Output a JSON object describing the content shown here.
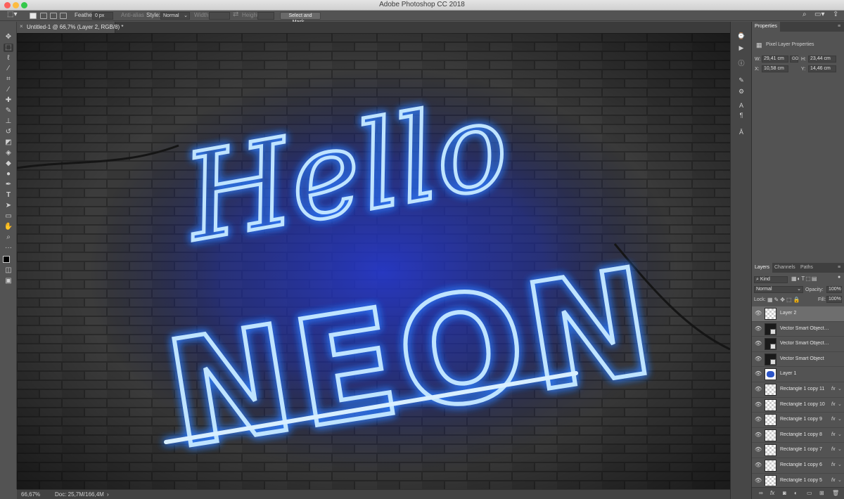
{
  "window": {
    "title": "Adobe Photoshop CC 2018"
  },
  "options_bar": {
    "feather_label": "Feather:",
    "feather_value": "0 px",
    "anti_alias_label": "Anti-alias",
    "style_label": "Style:",
    "style_value": "Normal",
    "width_label": "Width:",
    "height_label": "Height:",
    "select_mask_label": "Select and Mask..."
  },
  "document_tab": {
    "close": "×",
    "title": "Untitled-1 @ 66,7% (Layer 2, RGB/8) *"
  },
  "artwork": {
    "line1": "Hello",
    "line2": "NEON",
    "neon_color": "#4aa8ff",
    "glow_color": "#1e3dcc"
  },
  "status_bar": {
    "zoom": "66,67%",
    "doc_info": "Doc: 25,7M/166,4M",
    "arrow": "›"
  },
  "properties_panel": {
    "tab": "Properties",
    "header": "Pixel Layer Properties",
    "w_label": "W:",
    "w_value": "29,41 cm",
    "link_label": "GO",
    "h_label": "H:",
    "h_value": "23,44 cm",
    "x_label": "X:",
    "x_value": "10,58 cm",
    "y_label": "Y:",
    "y_value": "14,46 cm"
  },
  "layers_panel": {
    "tabs": [
      "Layers",
      "Channels",
      "Paths"
    ],
    "kind_label": "Kind",
    "blend_mode": "Normal",
    "opacity_label": "Opacity:",
    "opacity_value": "100%",
    "lock_label": "Lock:",
    "fill_label": "Fill:",
    "fill_value": "100%",
    "fx_label": "fx",
    "layers": [
      {
        "name": "Layer 2",
        "thumb": "checker",
        "fx": false,
        "selected": true
      },
      {
        "name": "Vector Smart Object c...",
        "thumb": "vec",
        "fx": false,
        "selected": false
      },
      {
        "name": "Vector Smart Object c...",
        "thumb": "vec",
        "fx": false,
        "selected": false
      },
      {
        "name": "Vector Smart Object",
        "thumb": "vec",
        "fx": false,
        "selected": false
      },
      {
        "name": "Layer 1",
        "thumb": "blue",
        "fx": false,
        "selected": false
      },
      {
        "name": "Rectangle 1 copy 11",
        "thumb": "checker",
        "fx": true,
        "selected": false
      },
      {
        "name": "Rectangle 1 copy 10",
        "thumb": "checker",
        "fx": true,
        "selected": false
      },
      {
        "name": "Rectangle 1 copy 9",
        "thumb": "checker",
        "fx": true,
        "selected": false
      },
      {
        "name": "Rectangle 1 copy 8",
        "thumb": "checker",
        "fx": true,
        "selected": false
      },
      {
        "name": "Rectangle 1 copy 7",
        "thumb": "checker",
        "fx": true,
        "selected": false
      },
      {
        "name": "Rectangle 1 copy 6",
        "thumb": "checker",
        "fx": true,
        "selected": false
      },
      {
        "name": "Rectangle 1 copy 5",
        "thumb": "checker",
        "fx": true,
        "selected": false
      }
    ]
  }
}
